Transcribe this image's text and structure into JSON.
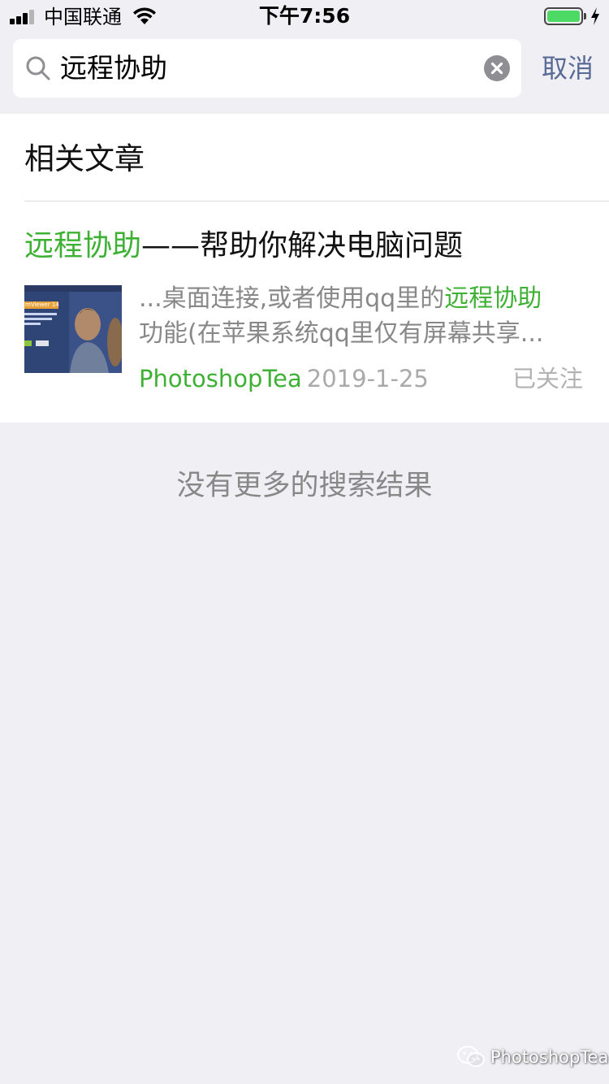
{
  "status_bar": {
    "carrier": "中国联通",
    "time": "下午7:56"
  },
  "search": {
    "query": "远程协助",
    "cancel_label": "取消"
  },
  "results": {
    "section_title": "相关文章",
    "article": {
      "title_highlight": "远程协助",
      "title_rest": "——帮助你解决电脑问题",
      "desc_line1_prefix": "...桌面连接,或者使用qq里的",
      "desc_line1_highlight": "远程协助",
      "desc_line2": "功能(在苹果系统qq里仅有屏幕共享...",
      "source": "PhotoshopTea",
      "date": "2019-1-25",
      "follow_status": "已关注",
      "thumbnail_text": "mViewer 14"
    }
  },
  "footer": {
    "no_more_results": "没有更多的搜索结果",
    "watermark": "PhotoshopTea"
  },
  "colors": {
    "highlight": "#3eb135",
    "link_blue": "#576b95",
    "background": "#efeff4"
  }
}
